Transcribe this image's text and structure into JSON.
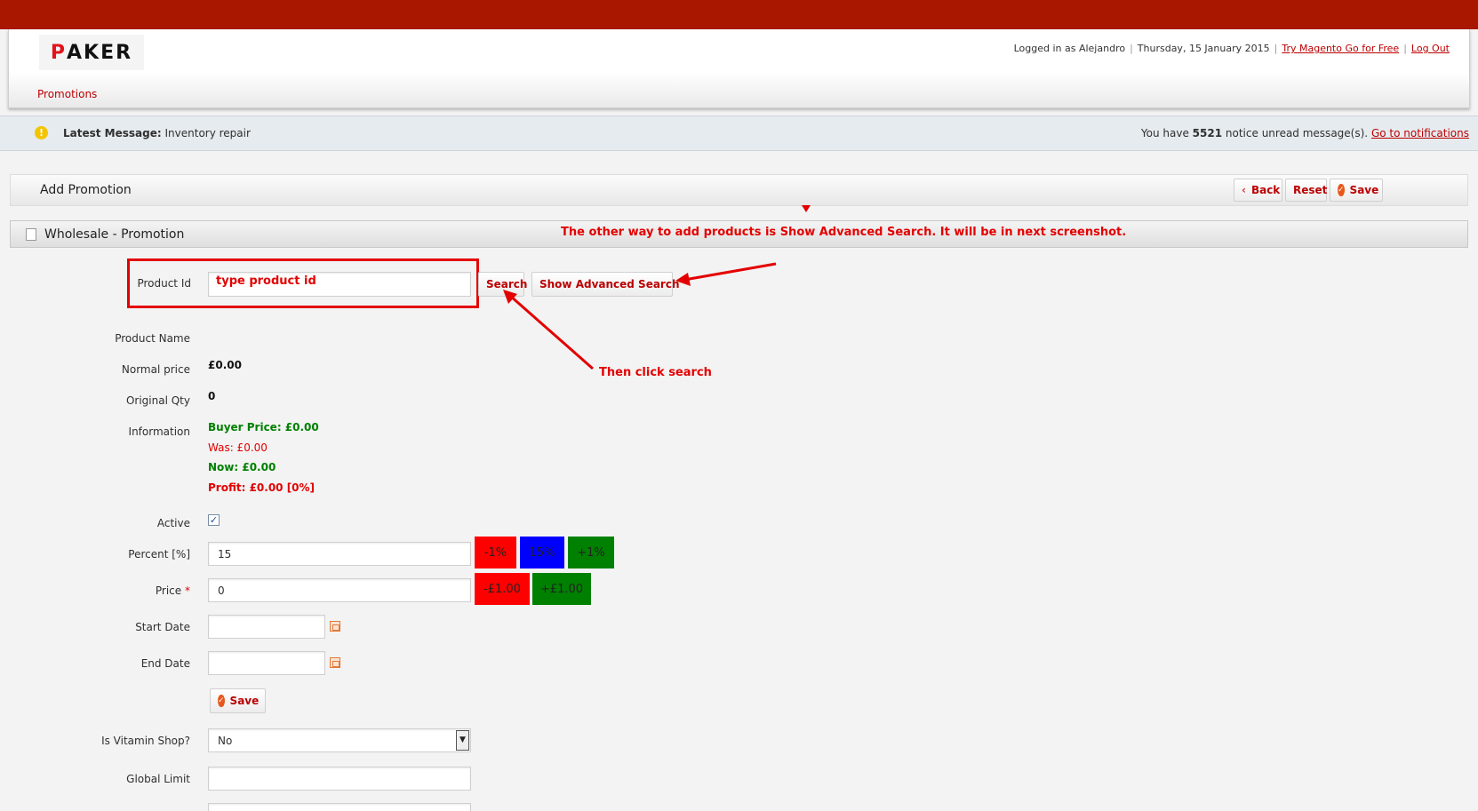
{
  "header": {
    "logo_letter": "P",
    "logo_rest": "AKER",
    "logged_in": "Logged in as Alejandro",
    "date": "Thursday, 15 January 2015",
    "try_link": "Try Magento Go for Free",
    "logout": "Log Out",
    "nav_item": "Promotions"
  },
  "notice": {
    "icon": "!",
    "label": "Latest Message:",
    "message": "Inventory repair",
    "count_prefix": "You have",
    "count": "5521",
    "count_suffix": "notice unread message(s).",
    "link": "Go to notifications"
  },
  "page": {
    "title": "Add Promotion",
    "back": "Back",
    "reset": "Reset",
    "save": "Save"
  },
  "section": {
    "title": "Wholesale - Promotion"
  },
  "form": {
    "product_id_label": "Product Id",
    "product_id_value": "",
    "search": "Search",
    "advanced": "Show Advanced Search",
    "product_name_label": "Product Name",
    "normal_price_label": "Normal price",
    "normal_price": "£0.00",
    "original_qty_label": "Original Qty",
    "original_qty": "0",
    "information_label": "Information",
    "buyer_price": "Buyer Price: £0.00",
    "was": "Was: £0.00",
    "now": "Now: £0.00",
    "profit": "Profit: £0.00 [0%]",
    "active_label": "Active",
    "percent_label": "Percent [%]",
    "percent_value": "15",
    "minus_pct": "-1%",
    "current_pct": "15%",
    "plus_pct": "+1%",
    "price_label": "Price",
    "required_mark": "*",
    "price_value": "0",
    "minus_price": "-£1.00",
    "plus_price": "+£1.00",
    "start_date_label": "Start Date",
    "end_date_label": "End Date",
    "save": "Save",
    "vitamin_label": "Is Vitamin Shop?",
    "vitamin_value": "No",
    "global_limit_label": "Global Limit"
  },
  "annotations": {
    "type_hint": "type product id",
    "advanced_note": "The other way to add products is Show Advanced Search. It will be in next screenshot.",
    "click_note": "Then click search"
  },
  "colors": {
    "brand_red": "#a91700",
    "link_red": "#bb0000",
    "annotation_red": "#e30000",
    "green": "#008000",
    "blue": "#0000ff"
  }
}
